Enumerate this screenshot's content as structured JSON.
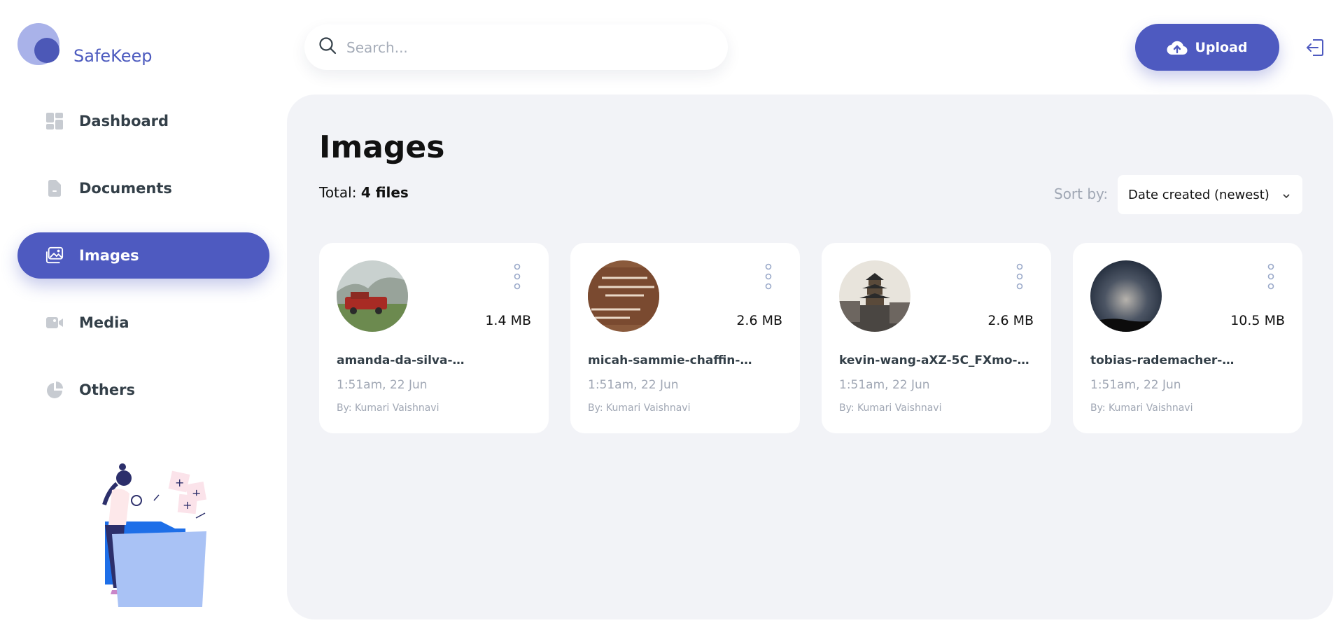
{
  "brand": {
    "name": "SafeKeep"
  },
  "sidebar": {
    "items": [
      {
        "label": "Dashboard",
        "icon": "dashboard-icon",
        "active": false
      },
      {
        "label": "Documents",
        "icon": "document-icon",
        "active": false
      },
      {
        "label": "Images",
        "icon": "images-icon",
        "active": true
      },
      {
        "label": "Media",
        "icon": "video-icon",
        "active": false
      },
      {
        "label": "Others",
        "icon": "pie-chart-icon",
        "active": false
      }
    ]
  },
  "search": {
    "placeholder": "Search..."
  },
  "header": {
    "upload_label": "Upload"
  },
  "main": {
    "title": "Images",
    "total_label": "Total:",
    "total_value": "4 files",
    "sort_label": "Sort by:",
    "sort_value": "Date created (newest)"
  },
  "files": [
    {
      "name": "amanda-da-silva-…",
      "size": "1.4 MB",
      "date": "1:51am, 22 Jun",
      "by": "By: Kumari Vaishnavi"
    },
    {
      "name": "micah-sammie-chaffin-…",
      "size": "2.6 MB",
      "date": "1:51am, 22 Jun",
      "by": "By: Kumari Vaishnavi"
    },
    {
      "name": "kevin-wang-aXZ-5C_FXmo-…",
      "size": "2.6 MB",
      "date": "1:51am, 22 Jun",
      "by": "By: Kumari Vaishnavi"
    },
    {
      "name": "tobias-rademacher-…",
      "size": "10.5 MB",
      "date": "1:51am, 22 Jun",
      "by": "By: Kumari Vaishnavi"
    }
  ],
  "colors": {
    "accent": "#4e5ac0",
    "panel": "#f2f3f7",
    "muted_text": "#a0a7b4"
  }
}
